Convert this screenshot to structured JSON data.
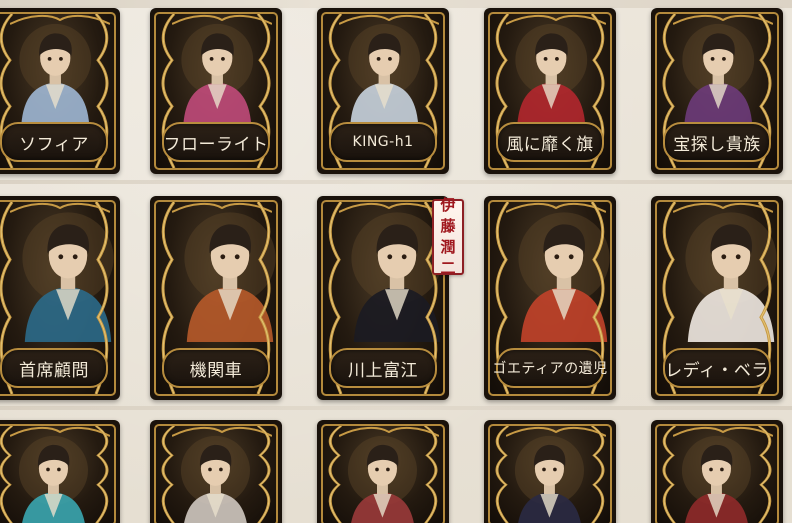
{
  "rows": [
    {
      "cards": [
        {
          "name": "ソフィア",
          "icon": "costume-portrait-icon",
          "accent": "#9fb7d4"
        },
        {
          "name": "フローライト",
          "icon": "costume-portrait-icon",
          "accent": "#c04a7a"
        },
        {
          "name": "KING-h1",
          "icon": "costume-portrait-icon",
          "accent": "#c8d3de"
        },
        {
          "name": "風に靡く旗",
          "icon": "costume-portrait-icon",
          "accent": "#b2272e"
        },
        {
          "name": "宝探し貴族",
          "icon": "costume-portrait-icon",
          "accent": "#6d3b7a"
        }
      ]
    },
    {
      "cards": [
        {
          "name": "首席顧問",
          "icon": "costume-portrait-icon",
          "accent": "#2b6a8a"
        },
        {
          "name": "機関車",
          "icon": "costume-portrait-icon",
          "accent": "#b75a2a"
        },
        {
          "name": "川上富江",
          "icon": "costume-portrait-icon",
          "accent": "#1b1b22"
        },
        {
          "name": "ゴエティアの遺児",
          "icon": "costume-portrait-icon",
          "accent": "#c2432a"
        },
        {
          "name": "レディ・ベラ",
          "icon": "costume-portrait-icon",
          "accent": "#efe9e2"
        }
      ]
    },
    {
      "cards": [
        {
          "name": "",
          "icon": "costume-portrait-icon",
          "accent": "#3aa6b0"
        },
        {
          "name": "",
          "icon": "costume-portrait-icon",
          "accent": "#cfc8c0"
        },
        {
          "name": "",
          "icon": "costume-portrait-icon",
          "accent": "#9a3a3a"
        },
        {
          "name": "",
          "icon": "costume-portrait-icon",
          "accent": "#2a2a44"
        },
        {
          "name": "",
          "icon": "costume-portrait-icon",
          "accent": "#8f2a2a"
        }
      ]
    }
  ],
  "collab_tag": {
    "chars": [
      "伊",
      "藤",
      "潤",
      "二"
    ],
    "color": "#a0181f"
  },
  "colors": {
    "gold": "#b88d3e",
    "plate": "#1a130d",
    "background": "#e9e2d6"
  }
}
